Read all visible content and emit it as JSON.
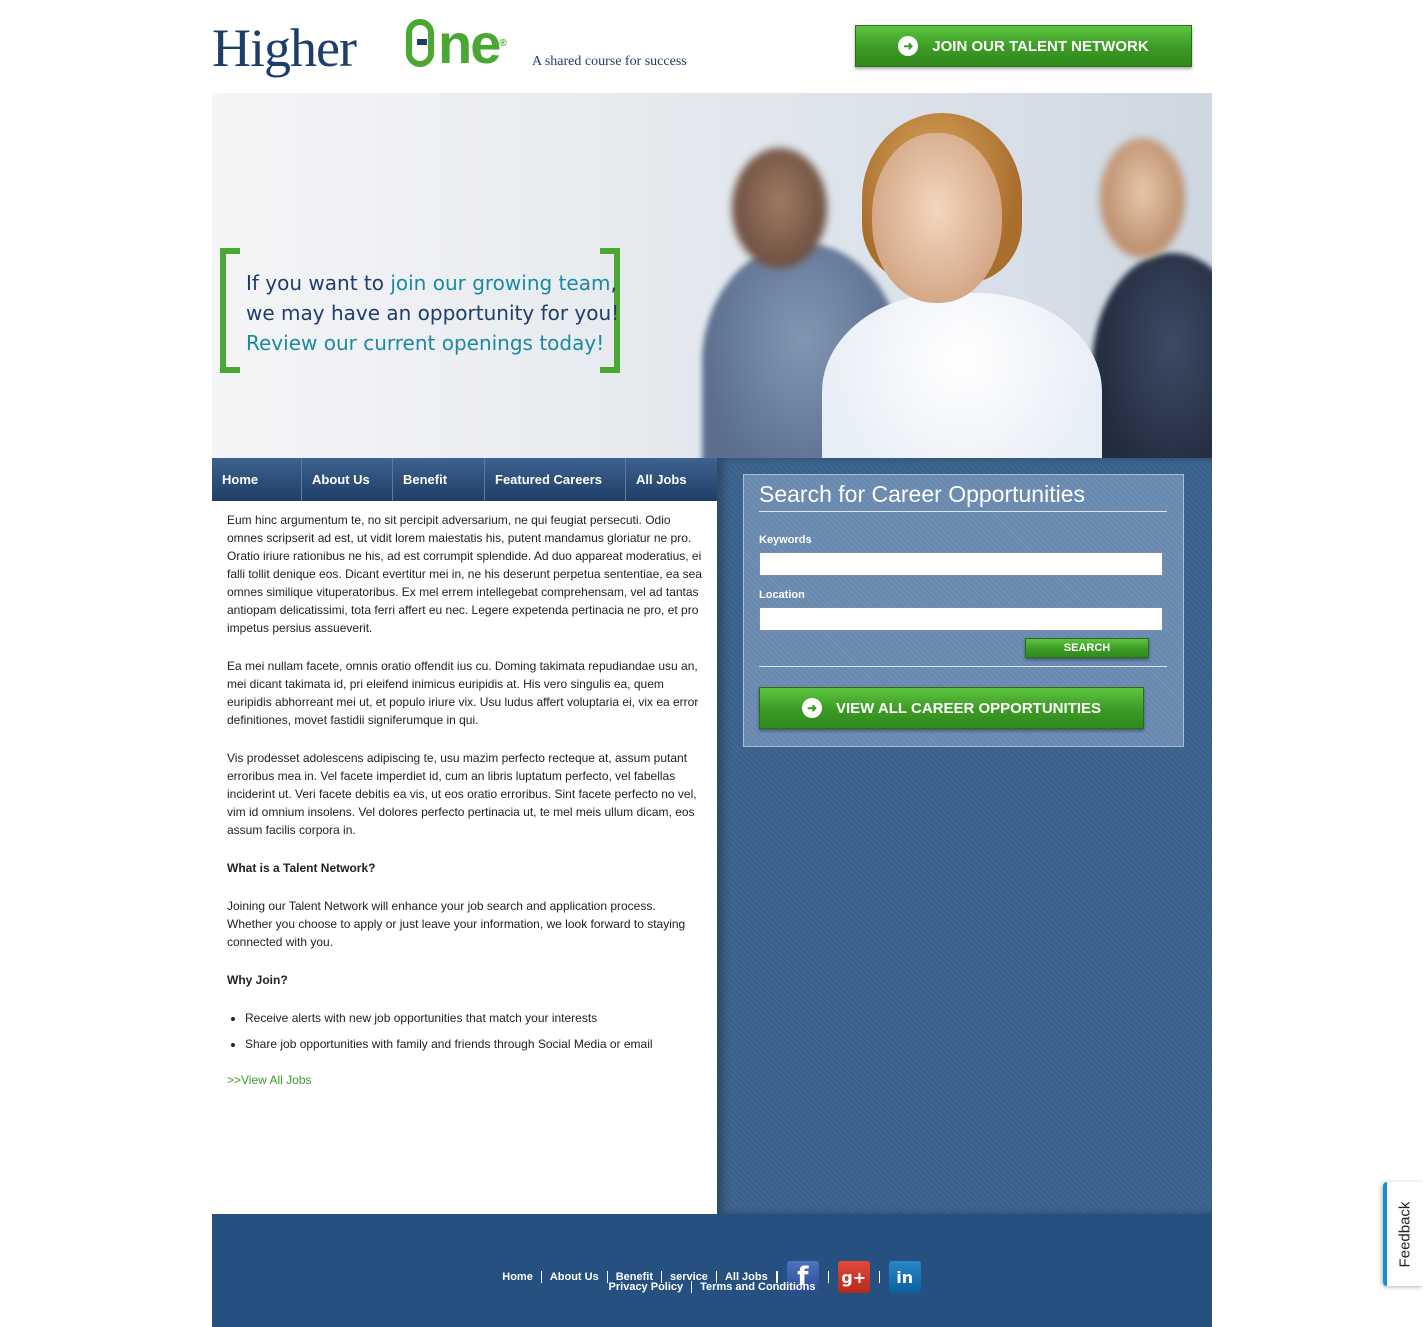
{
  "brand": {
    "logo_word1": "Higher",
    "logo_word2": "ne",
    "registered": "®",
    "tagline": "A shared course for success"
  },
  "header": {
    "join_label": "JOIN OUR TALENT NETWORK"
  },
  "hero": {
    "line1_a": "If you want to ",
    "line1_b": "join our growing team",
    "line1_c": ",",
    "line2": "we may have an opportunity for you!",
    "line3": "Review our current openings today!"
  },
  "nav": {
    "items": [
      "Home",
      "About Us",
      "Benefit",
      "Featured Careers",
      "All Jobs"
    ]
  },
  "content": {
    "p1": "Eum hinc argumentum te, no sit percipit adversarium, ne qui feugiat persecuti. Odio omnes scripserit ad est, ut vidit lorem maiestatis his, putent mandamus gloriatur ne pro. Oratio iriure rationibus ne his, ad est corrumpit splendide. Ad duo appareat moderatius, ei falli tollit denique eos. Dicant evertitur mei in, ne his deserunt perpetua sententiae, ea sea omnes similique vituperatoribus. Ex mel errem intellegebat comprehensam, vel ad tantas antiopam delicatissimi, tota ferri affert eu nec. Legere expetenda pertinacia ne pro, et pro impetus persius assueverit.",
    "p2": "Ea mei nullam facete, omnis oratio offendit ius cu. Doming takimata repudiandae usu an, mei dicant takimata id, pri eleifend inimicus euripidis at. His vero singulis ea, quem euripidis abhorreant mei ut, et populo iriure vix. Usu ludus affert voluptaria ei, vix ea error definitiones, movet fastidii signiferumque in qui.",
    "p3": "Vis prodesset adolescens adipiscing te, usu mazim perfecto recteque at, assum putant erroribus mea in. Vel facete imperdiet id, cum an libris luptatum perfecto, vel fabellas inciderint ut. Veri facete debitis ea vis, ut eos oratio erroribus. Sint facete perfecto no vel, vim id omnium insolens. Vel dolores perfecto pertinacia ut, te mel meis ullum dicam, eos assum facilis corpora in.",
    "h_talent": "What is a Talent Network?",
    "p4": "Joining our Talent Network will enhance your job search and application process. Whether you choose to apply or just leave your information, we look forward to staying connected with you.",
    "h_why": "Why Join?",
    "bullets": [
      "Receive alerts with new job opportunities that match your interests",
      "Share job opportunities with family and friends through Social Media or email"
    ],
    "view_all_link": ">>View All Jobs"
  },
  "search": {
    "title": "Search for Career Opportunities",
    "keywords_label": "Keywords",
    "keywords_value": "",
    "location_label": "Location",
    "location_value": "",
    "search_button": "SEARCH",
    "view_all_button": "VIEW ALL CAREER OPPORTUNITIES"
  },
  "footer": {
    "links": [
      "Home",
      "About Us",
      "Benefit",
      "service",
      "All Jobs"
    ],
    "links2": [
      "Privacy Policy",
      "Terms and Conditions"
    ],
    "social": {
      "facebook": "f",
      "googleplus": "g+",
      "linkedin": "in"
    }
  },
  "feedback_label": "Feedback",
  "colors": {
    "brand_navy": "#1d3d6b",
    "brand_green": "#4aa832",
    "panel_blue": "#38608a",
    "footer_blue": "#25507f"
  }
}
